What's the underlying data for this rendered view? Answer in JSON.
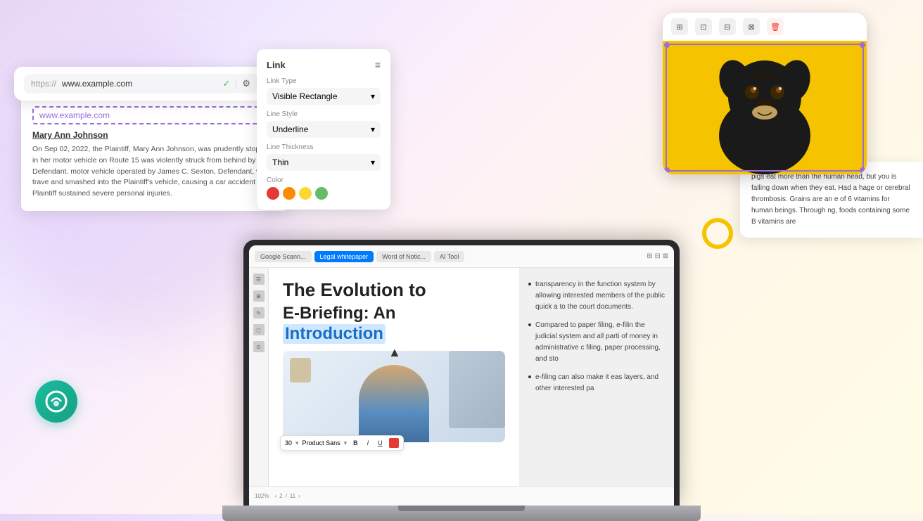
{
  "background": {
    "gradient": "linear-gradient(135deg, #e8d5f5, #fdf0f8, #fff8e8)"
  },
  "url_card": {
    "scheme": "https://",
    "domain": "www.example.com",
    "check_icon": "✓",
    "settings_icon": "⚙"
  },
  "selection_box_text": "www.example.com",
  "legal_card": {
    "name": "Mary Ann Johnson",
    "body": "On Sep 02, 2022, the Plaintiff, Mary Ann Johnson, was prudently stopped in her motor vehicle on Route 15 was violently struck from behind by the Defendant. motor vehicle operated by James C. Sexton, Defendant, was trave and smashed into the Plaintiff's vehicle, causing a car accident in the Plaintiff sustained severe personal injuries."
  },
  "link_panel": {
    "title": "Link",
    "link_type_label": "Link Type",
    "link_type_value": "Visible Rectangle",
    "line_style_label": "Line Style",
    "line_style_value": "Underline",
    "line_thickness_label": "Line Thickness",
    "line_thickness_value": "Thin",
    "color_label": "Color",
    "colors": [
      "#e53935",
      "#fb8c00",
      "#fdd835",
      "#66bb6a"
    ]
  },
  "laptop_screen": {
    "toolbar_tabs": [
      "Google Scann...",
      "Legal whitepaper",
      "Word of Notic...",
      "AI Tool"
    ],
    "active_tab": "Legal whitepaper",
    "doc_title_line1": "The Evolution to",
    "doc_title_line2": "E-Briefing: An",
    "doc_title_highlight": "Introduction",
    "cursor_icon": "▲",
    "format_bar": {
      "size": "30",
      "font": "Product Sans",
      "bold": "B",
      "italic": "I",
      "underline": "U"
    },
    "right_text_bullets": [
      "transparency in the function system by allowing interested members of the public quick a to the court documents.",
      "Compared to paper filing, e-filin the judicial system and all parti of money in administrative c filing, paper processing, and sto",
      "e-filing can also make it eas layers, and other interested pa"
    ],
    "bottom_bar": {
      "zoom": "102%",
      "page_current": "2",
      "page_total": "11"
    }
  },
  "dog_card": {
    "toolbar_icons": [
      "⊞",
      "⊡",
      "⊟",
      "⊠"
    ],
    "delete_icon": "🗑",
    "alt": "Black pug dog on yellow background"
  },
  "text_card": {
    "body": "pigs eat more than the human head, but you is falling down when they eat. Had a hage or cerebral thrombosis. Grains are an e of 6 vitamins for human beings. Through ng, foods containing some B vitamins are"
  },
  "teal_logo": {
    "label": "UPDF logo"
  },
  "yellow_ring": {
    "label": "decorative ring"
  }
}
